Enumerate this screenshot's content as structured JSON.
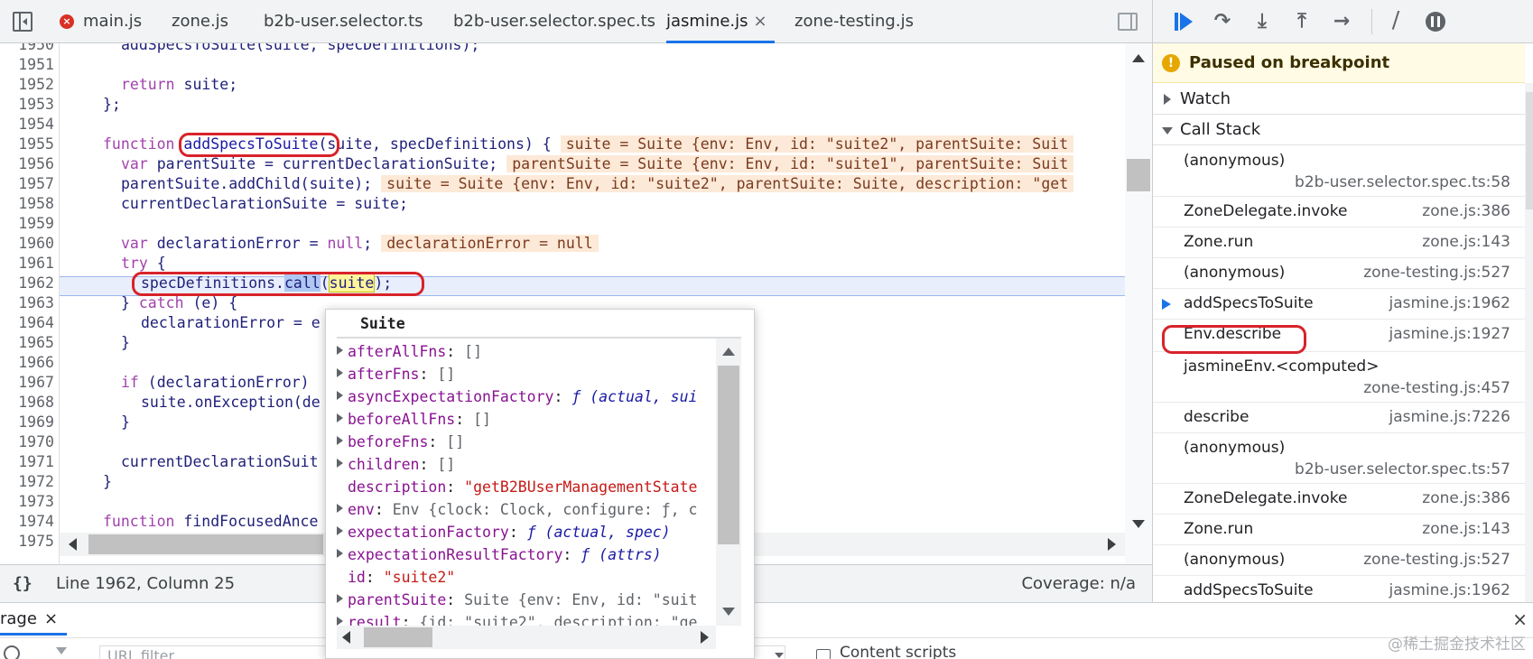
{
  "tabs": [
    {
      "label": "main.js",
      "error": true
    },
    {
      "label": "zone.js"
    },
    {
      "label": "b2b-user.selector.ts"
    },
    {
      "label": "b2b-user.selector.spec.ts"
    },
    {
      "label": "jasmine.js",
      "active": true,
      "close": "×"
    },
    {
      "label": "zone-testing.js"
    }
  ],
  "editor": {
    "lines": [
      "1950",
      "1951",
      "1952",
      "1953",
      "1954",
      "1955",
      "1956",
      "1957",
      "1958",
      "1959",
      "1960",
      "1961",
      "1962",
      "1963",
      "1964",
      "1965",
      "1966",
      "1967",
      "1968",
      "1969",
      "1970",
      "1971",
      "1972",
      "1973",
      "1974",
      "1975"
    ],
    "code": {
      "l1950": "addSpecsToSuite(suite, specDefinitions);",
      "l1952_kw": "return",
      "l1952_rest": " suite;",
      "l1953": "};",
      "l1955_kw": "function",
      "l1955_fn": "addSpecsToSuite",
      "l1955_rest": "(suite, specDefinitions) {",
      "l1955_inline": "suite = Suite {env: Env, id: \"suite2\", parentSuite: Suit",
      "l1956_kw": "var",
      "l1956_rest": " parentSuite = currentDeclarationSuite;",
      "l1956_inline": "parentSuite = Suite {env: Env, id: \"suite1\", parentSuite: Suit",
      "l1957": "parentSuite.addChild(suite);",
      "l1957_inline": "suite = Suite {env: Env, id: \"suite2\", parentSuite: Suite, description: \"get",
      "l1958": "currentDeclarationSuite = suite;",
      "l1960_kw": "var",
      "l1960_rest": " declarationError = ",
      "l1960_null": "null",
      "l1960_semi": ";",
      "l1960_inline": "declarationError = null",
      "l1961_kw": "try",
      "l1961_rest": " {",
      "l1962_a": "specDefinitions.",
      "l1962_call": "call",
      "l1962_p1": "(",
      "l1962_suite": "suite",
      "l1962_p2": ");",
      "l1963_a": "} ",
      "l1963_kw": "catch",
      "l1963_rest": " (e) {",
      "l1964": "declarationError = e",
      "l1965": "}",
      "l1967_kw": "if",
      "l1967_rest": " (declarationError)",
      "l1968": "suite.onException(de",
      "l1969": "}",
      "l1971": "currentDeclarationSuit",
      "l1972": "}",
      "l1974_kw": "function",
      "l1974_rest": " findFocusedAnce"
    }
  },
  "status": {
    "brace": "{}",
    "position": "Line 1962, Column 25",
    "coverage": "Coverage: n/a"
  },
  "popover": {
    "title": "Suite",
    "props": [
      {
        "key": "afterAllFns",
        "sep": ": ",
        "val": "[]",
        "kind": "t",
        "exp": true
      },
      {
        "key": "afterFns",
        "sep": ": ",
        "val": "[]",
        "kind": "t",
        "exp": true
      },
      {
        "key": "asyncExpectationFactory",
        "sep": ": ",
        "val": "ƒ (actual, sui",
        "kind": "f",
        "exp": true
      },
      {
        "key": "beforeAllFns",
        "sep": ": ",
        "val": "[]",
        "kind": "t",
        "exp": true
      },
      {
        "key": "beforeFns",
        "sep": ": ",
        "val": "[]",
        "kind": "t",
        "exp": true
      },
      {
        "key": "children",
        "sep": ": ",
        "val": "[]",
        "kind": "t",
        "exp": true
      },
      {
        "key": "description",
        "sep": ": ",
        "val": "\"getB2BUserManagementState",
        "kind": "s",
        "exp": false
      },
      {
        "key": "env",
        "sep": ": ",
        "val": "Env {clock: Clock, configure: ƒ, c",
        "kind": "t",
        "exp": true
      },
      {
        "key": "expectationFactory",
        "sep": ": ",
        "val": "ƒ (actual, spec)",
        "kind": "f",
        "exp": true
      },
      {
        "key": "expectationResultFactory",
        "sep": ": ",
        "val": "ƒ (attrs)",
        "kind": "f",
        "exp": true
      },
      {
        "key": "id",
        "sep": ": ",
        "val": "\"suite2\"",
        "kind": "s",
        "exp": false
      },
      {
        "key": "parentSuite",
        "sep": ": ",
        "val": "Suite {env: Env, id: \"suit",
        "kind": "t",
        "exp": true
      },
      {
        "key": "result",
        "sep": ": ",
        "val": "{id: \"suite2\", description: \"ge",
        "kind": "t",
        "exp": true
      }
    ]
  },
  "sidebar": {
    "paused": "Paused on breakpoint",
    "watch": "Watch",
    "callstack": "Call Stack",
    "frames": [
      {
        "fn": "(anonymous)",
        "loc": "b2b-user.selector.spec.ts:58",
        "two": true
      },
      {
        "fn": "ZoneDelegate.invoke",
        "loc": "zone.js:386"
      },
      {
        "fn": "Zone.run",
        "loc": "zone.js:143"
      },
      {
        "fn": "(anonymous)",
        "loc": "zone-testing.js:527"
      },
      {
        "fn": "addSpecsToSuite",
        "loc": "jasmine.js:1962",
        "current": true
      },
      {
        "fn": "Env.describe",
        "loc": "jasmine.js:1927",
        "circled": true
      },
      {
        "fn": "jasmineEnv.<computed>",
        "loc": "zone-testing.js:457",
        "two": true
      },
      {
        "fn": "describe",
        "loc": "jasmine.js:7226"
      },
      {
        "fn": "(anonymous)",
        "loc": "b2b-user.selector.spec.ts:57",
        "two": true
      },
      {
        "fn": "ZoneDelegate.invoke",
        "loc": "zone.js:386"
      },
      {
        "fn": "Zone.run",
        "loc": "zone.js:143"
      },
      {
        "fn": "(anonymous)",
        "loc": "zone-testing.js:527"
      },
      {
        "fn": "addSpecsToSuite",
        "loc": "jasmine.js:1962"
      }
    ]
  },
  "drawer": {
    "tab": "rage",
    "close": "×",
    "url_filter_placeholder": "URL filter",
    "content_scripts": "Content scripts",
    "drawer_close": "×"
  },
  "watermark": "@稀土掘金技术社区",
  "colors": {
    "accent": "#1a73e8",
    "annotation_red": "#d8232a"
  }
}
